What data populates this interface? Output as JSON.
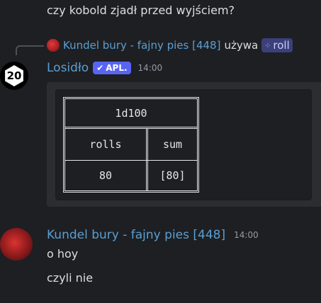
{
  "top_message": {
    "text": "czy kobold zjadł przed wyjściem?"
  },
  "interaction": {
    "user_name": "Kundel bury - fajny pies [448]",
    "uses_text": "używa",
    "command_icon": "slash-command-icon",
    "command": "roll"
  },
  "bot_message": {
    "author": "Losidło",
    "badge_check_icon": "checkmark-icon",
    "badge": "APL.",
    "timestamp": "14:00",
    "avatar_text": "20",
    "avatar_icon": "d20-dice-icon",
    "table": {
      "title": "1d100",
      "headers": [
        "rolls",
        "sum"
      ],
      "row": [
        "80",
        "[80]"
      ]
    }
  },
  "user_message": {
    "author": "Kundel bury - fajny pies [448]",
    "timestamp": "14:00",
    "lines": [
      "o hoy",
      "czyli nie"
    ]
  },
  "colors": {
    "background": "#1e1f22",
    "name_color": "#5a9fd4",
    "app_badge": "#5865f2",
    "embed_bg": "#2b2d31"
  }
}
